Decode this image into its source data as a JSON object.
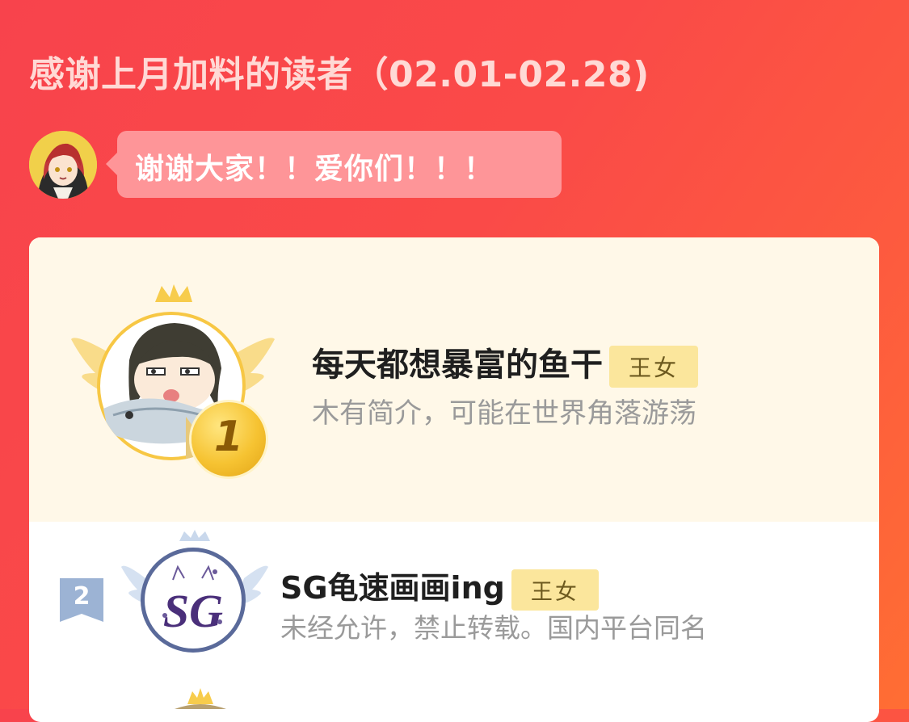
{
  "header": {
    "title": "感谢上月加料的读者（02.01-02.28)"
  },
  "host": {
    "message": "谢谢大家！！爱你们！！！"
  },
  "ranking": [
    {
      "rank": "1",
      "name": "每天都想暴富的鱼干",
      "badge": "王女",
      "bio": "木有简介，可能在世界角落游荡"
    },
    {
      "rank": "2",
      "name": "SG龟速画画ing",
      "badge": "王女",
      "bio": "未经允许，禁止转载。国内平台同名",
      "avatar_text": "SG"
    }
  ],
  "colors": {
    "accent_red": "#fa4a48",
    "rank1_bg": "#fff8e8",
    "badge_bg": "#fbe69c",
    "gold": "#f6c332"
  }
}
